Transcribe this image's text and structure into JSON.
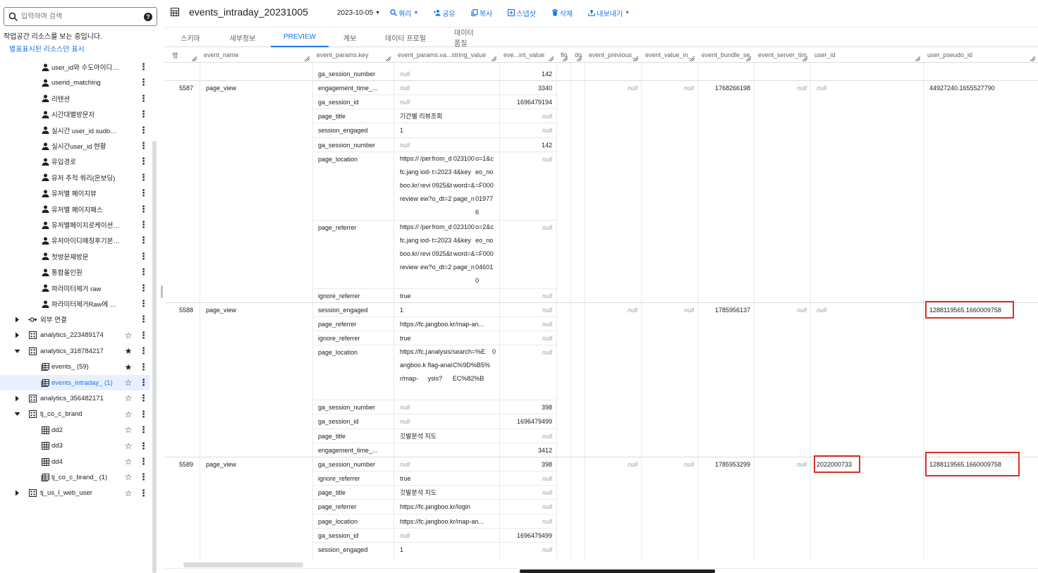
{
  "sidebar": {
    "search_placeholder": "입력하여 검색",
    "ws_note": "작업공간 리소스를 보는 중입니다.",
    "star_only": "별표표시된 리소스만 표시",
    "items": [
      {
        "label": "user_id와 수도아이디 카...",
        "icon": "person-icon",
        "indent": 2
      },
      {
        "label": "userid_matching",
        "icon": "person-icon",
        "indent": 2
      },
      {
        "label": "리텐션",
        "icon": "person-icon",
        "indent": 2
      },
      {
        "label": "시간대별방문자",
        "icon": "person-icon",
        "indent": 2
      },
      {
        "label": "실시간 user_id sudo_id 카...",
        "icon": "person-icon",
        "indent": 2
      },
      {
        "label": "실시간user_id 현황",
        "icon": "person-icon",
        "indent": 2
      },
      {
        "label": "유입경로",
        "icon": "person-icon",
        "indent": 2
      },
      {
        "label": "유저 추적 쿼리(온보딩)",
        "icon": "person-icon",
        "indent": 2
      },
      {
        "label": "유저별 페이지뷰",
        "icon": "person-icon",
        "indent": 2
      },
      {
        "label": "유저별 페이지패스",
        "icon": "person-icon",
        "indent": 2
      },
      {
        "label": "유저별페이지로케이션(공...",
        "icon": "person-icon",
        "indent": 2
      },
      {
        "label": "유저아이디매칭후기본정...",
        "icon": "person-icon",
        "indent": 2
      },
      {
        "label": "첫방문재방문",
        "icon": "person-icon",
        "indent": 2
      },
      {
        "label": "통합올인원",
        "icon": "person-icon",
        "indent": 2
      },
      {
        "label": "파라미터제거 raw",
        "icon": "person-icon",
        "indent": 2
      },
      {
        "label": "파라미터제거Raw에 dd3...",
        "icon": "person-icon",
        "indent": 2
      },
      {
        "label": "외부 연결",
        "icon": "external-connection-icon",
        "indent": 1,
        "expander": "right"
      },
      {
        "label": "analytics_223489174",
        "icon": "dataset-icon",
        "indent": 1,
        "expander": "right",
        "star": "outline"
      },
      {
        "label": "analytics_318784217",
        "icon": "dataset-icon",
        "indent": 1,
        "expander": "down",
        "star": "filled"
      },
      {
        "label": "events_ (59)",
        "icon": "sharded-table-icon",
        "indent": 2,
        "star": "filled"
      },
      {
        "label": "events_intraday_ (1)",
        "icon": "sharded-table-icon",
        "indent": 2,
        "star": "outline",
        "selected": true
      },
      {
        "label": "analytics_356482171",
        "icon": "dataset-icon",
        "indent": 1,
        "expander": "right",
        "star": "outline"
      },
      {
        "label": "tj_co_c_brand",
        "icon": "dataset-icon",
        "indent": 1,
        "expander": "down",
        "star": "outline"
      },
      {
        "label": "dd2",
        "icon": "table-icon",
        "indent": 2,
        "star": "outline"
      },
      {
        "label": "dd3",
        "icon": "table-icon",
        "indent": 2,
        "star": "outline"
      },
      {
        "label": "dd4",
        "icon": "table-icon",
        "indent": 2,
        "star": "outline"
      },
      {
        "label": "tj_co_c_brand_ (1)",
        "icon": "sharded-table-icon",
        "indent": 2,
        "star": "outline"
      },
      {
        "label": "tj_us_l_web_user",
        "icon": "dataset-icon",
        "indent": 1,
        "expander": "right",
        "star": "outline"
      }
    ]
  },
  "header": {
    "title": "events_intraday_20231005",
    "date": "2023-10-05",
    "query": "쿼리",
    "share": "공유",
    "copy": "복사",
    "snapshot": "스냅샷",
    "delete": "삭제",
    "export": "내보내기"
  },
  "tabs": [
    {
      "label": "스키마"
    },
    {
      "label": "세부정보"
    },
    {
      "label": "PREVIEW",
      "active": true
    },
    {
      "label": "계보"
    },
    {
      "label": "데이터 프로필"
    },
    {
      "label": "데이터 품질"
    }
  ],
  "grid": {
    "columns": [
      "행",
      "event_name",
      "event_params.key",
      "event_params.va...string_value",
      "eve...int_value",
      "flo",
      "do",
      "event_previous_",
      "event_value_in_",
      "event_bundle_se",
      "event_server_tim",
      "user_id",
      "user_pseudo_id"
    ],
    "null_text": "null",
    "param_rows": [
      {
        "key": "ga_session_number",
        "string_value": "null",
        "int_value": "142"
      },
      {
        "key": "engagement_time_...",
        "string_value": "null",
        "int_value": "3340"
      },
      {
        "key": "ga_session_id",
        "string_value": "null",
        "int_value": "1696479194"
      },
      {
        "key": "page_title",
        "string_value": "기간별 리뷰조회",
        "int_value": "null"
      },
      {
        "key": "session_engaged",
        "string_value": "1",
        "int_value": "null"
      },
      {
        "key": "ga_session_number",
        "string_value": "null",
        "int_value": "142"
      },
      {
        "key": "page_location",
        "string_value": "https://fc.jangboo.kr/review/period-review?from_dt=20230925&to_dt=20231004&keyword=&page_no=1&ceo_no=F000019776",
        "int_value": "null"
      },
      {
        "key": "page_referrer",
        "string_value": "https://fc.jangboo.kr/review/period-review?from_dt=20230925&to_dt=20231004&keyword=&page_no=2&ceo_no=F000046010",
        "int_value": "null"
      },
      {
        "key": "ignore_referrer",
        "string_value": "true",
        "int_value": "null"
      },
      {
        "key": "session_engaged",
        "string_value": "1",
        "int_value": "null"
      },
      {
        "key": "page_referrer",
        "string_value": "https://fc.jangboo.kr/map-an...",
        "int_value": "null"
      },
      {
        "key": "ignore_referrer",
        "string_value": "true",
        "int_value": "null"
      },
      {
        "key": "page_location",
        "string_value": "https://fc.jangboo.kr/map-analysis/flag-analysis?search=%EC%9D%B5%EC%82%B0",
        "int_value": "null"
      },
      {
        "key": "ga_session_number",
        "string_value": "null",
        "int_value": "398"
      },
      {
        "key": "ga_session_id",
        "string_value": "null",
        "int_value": "1696479499"
      },
      {
        "key": "page_title",
        "string_value": "깃발분석 지도",
        "int_value": "null"
      },
      {
        "key": "engagement_time_...",
        "string_value": "",
        "int_value": "3412"
      },
      {
        "key": "ga_session_number",
        "string_value": "null",
        "int_value": "398"
      },
      {
        "key": "ignore_referrer",
        "string_value": "true",
        "int_value": "null"
      },
      {
        "key": "page_title",
        "string_value": "깃발분석 지도",
        "int_value": "null"
      },
      {
        "key": "page_referrer",
        "string_value": "https://fc.jangboo.kr/login",
        "int_value": "null"
      },
      {
        "key": "page_location",
        "string_value": "https://fc.jangboo.kr/map-an...",
        "int_value": "null"
      },
      {
        "key": "ga_session_id",
        "string_value": "null",
        "int_value": "1696479499"
      },
      {
        "key": "session_engaged",
        "string_value": "1",
        "int_value": "null"
      }
    ],
    "records": [
      {
        "row": "5587",
        "event_name": "page_view",
        "previous": "null",
        "value_in": "null",
        "bundle": "1768266198",
        "server": "null",
        "user_id": "null",
        "pseudo": "44927240.1655527790"
      },
      {
        "row": "5588",
        "event_name": "page_view",
        "previous": "null",
        "value_in": "null",
        "bundle": "1785956137",
        "server": "null",
        "user_id": "null",
        "pseudo": "1288119565.1660009758"
      },
      {
        "row": "5589",
        "event_name": "page_view",
        "previous": "null",
        "value_in": "null",
        "bundle": "1785953299",
        "server": "null",
        "user_id": "2022000733",
        "pseudo": "1288119565.1660009758"
      }
    ]
  }
}
